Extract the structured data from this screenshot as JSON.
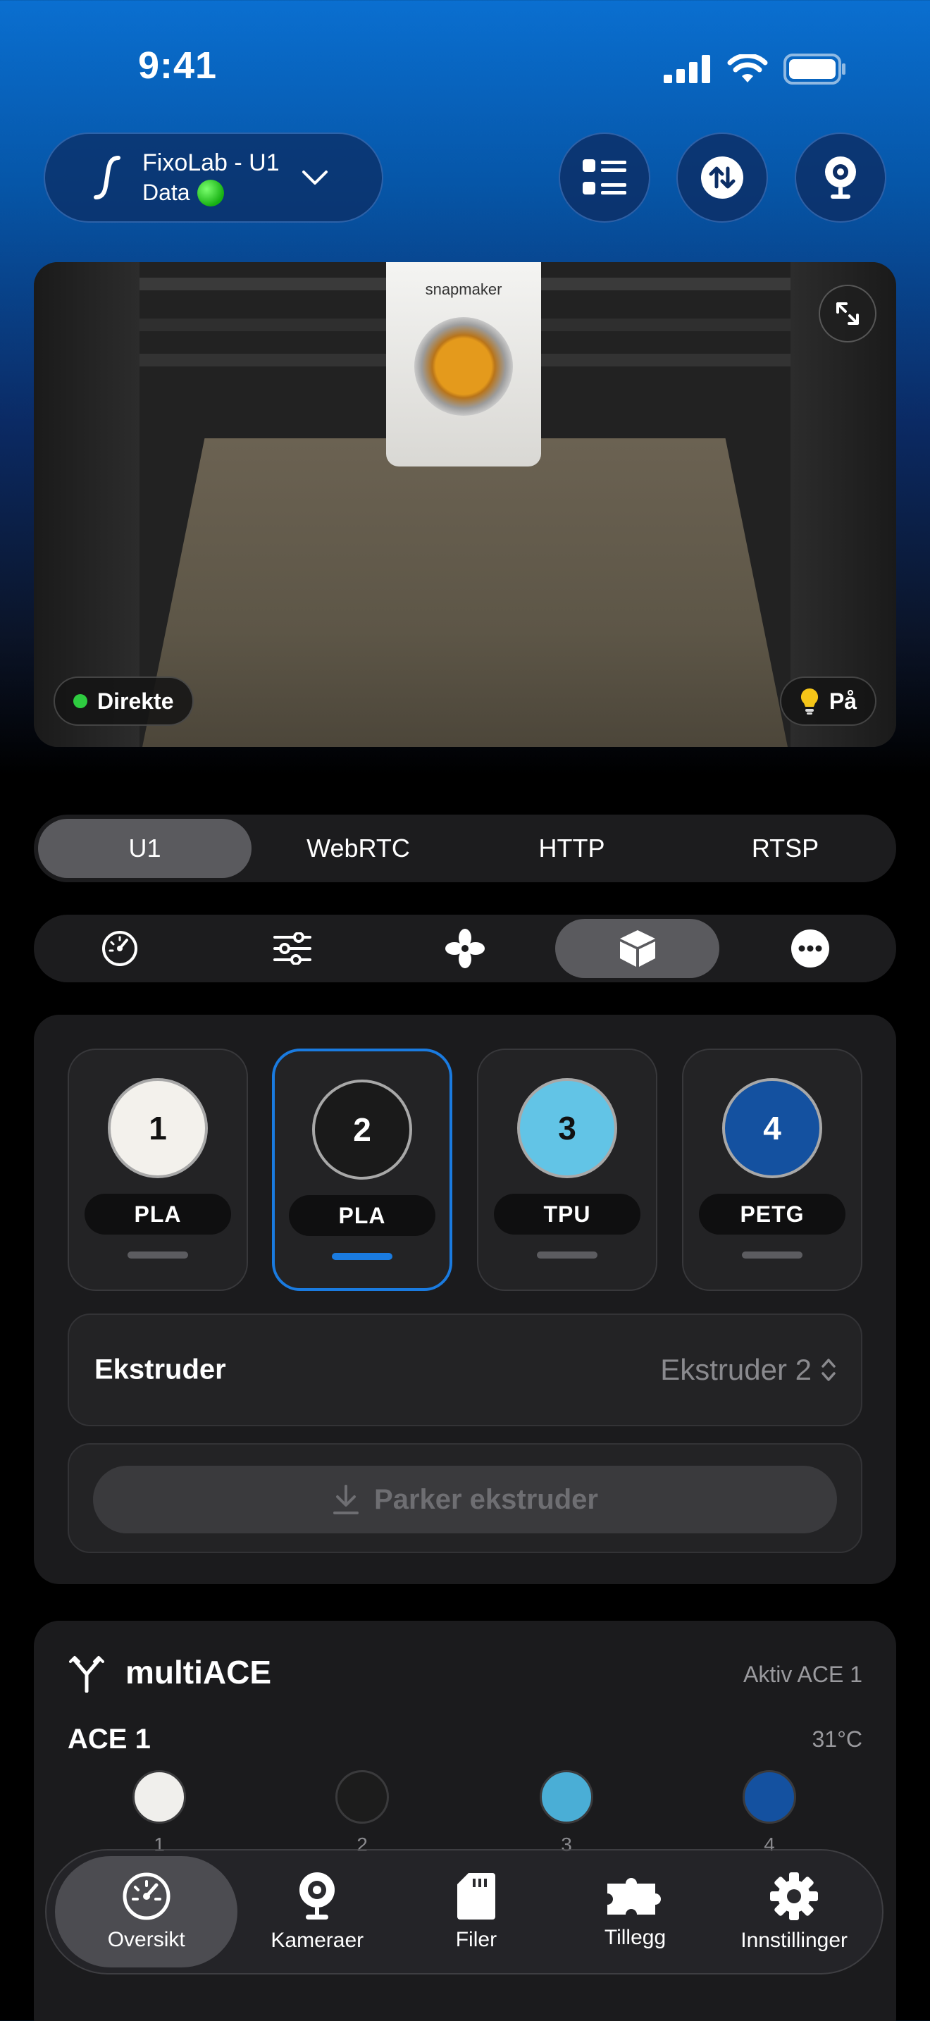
{
  "status_bar": {
    "time": "9:41"
  },
  "header": {
    "printer_name": "FixoLab - U1",
    "connection_label": "Data",
    "buttons": [
      "list-icon",
      "transfer-icon",
      "webcam-icon"
    ]
  },
  "camera": {
    "brand": "snapmaker",
    "live_label": "Direkte",
    "light_label": "På"
  },
  "stream_tabs": [
    {
      "label": "U1",
      "active": true
    },
    {
      "label": "WebRTC",
      "active": false
    },
    {
      "label": "HTTP",
      "active": false
    },
    {
      "label": "RTSP",
      "active": false
    }
  ],
  "control_tabs": [
    {
      "icon": "gauge-icon",
      "active": false
    },
    {
      "icon": "sliders-icon",
      "active": false
    },
    {
      "icon": "fan-icon",
      "active": false
    },
    {
      "icon": "box-icon",
      "active": true
    },
    {
      "icon": "more-icon",
      "active": false
    }
  ],
  "filament": {
    "slots": [
      {
        "number": "1",
        "type": "PLA",
        "color": "#f3f1ec",
        "selected": false
      },
      {
        "number": "2",
        "type": "PLA",
        "color": "#1a1a1a",
        "selected": true
      },
      {
        "number": "3",
        "type": "TPU",
        "color": "#62c4e6",
        "selected": false
      },
      {
        "number": "4",
        "type": "PETG",
        "color": "#1451a0",
        "selected": false
      }
    ],
    "extruder_label": "Ekstruder",
    "extruder_value": "Ekstruder 2",
    "park_label": "Parker ekstruder"
  },
  "multiace": {
    "title": "multiACE",
    "active_label": "Aktiv ACE 1",
    "unit_name": "ACE 1",
    "temperature": "31°C",
    "slots": [
      {
        "number": "1",
        "color": "#f0efec"
      },
      {
        "number": "2",
        "color": "#1c1c1c"
      },
      {
        "number": "3",
        "color": "#4aaed6"
      },
      {
        "number": "4",
        "color": "#1451a0"
      }
    ]
  },
  "bottom_nav": [
    {
      "label": "Oversikt",
      "icon": "gauge-icon",
      "active": true
    },
    {
      "label": "Kameraer",
      "icon": "webcam-icon",
      "active": false
    },
    {
      "label": "Filer",
      "icon": "sdcard-icon",
      "active": false
    },
    {
      "label": "Tillegg",
      "icon": "puzzle-icon",
      "active": false
    },
    {
      "label": "Innstillinger",
      "icon": "gear-icon",
      "active": false
    }
  ],
  "colors": {
    "accent": "#1a7be0",
    "live": "#2ecc40",
    "connected": "#16b012"
  }
}
